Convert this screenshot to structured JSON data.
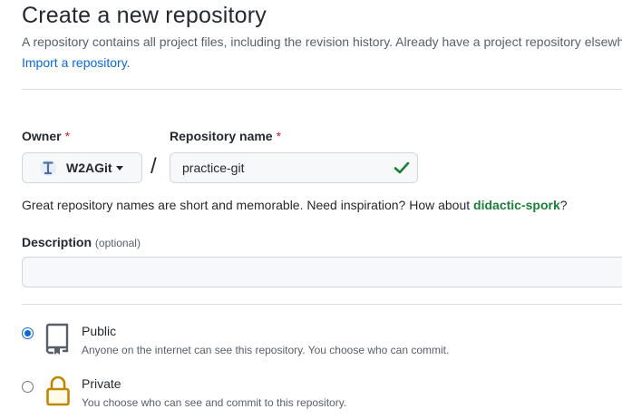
{
  "page": {
    "title": "Create a new repository",
    "subtitle": "A repository contains all project files, including the revision history. Already have a project repository elsewhere?",
    "import_link": "Import a repository."
  },
  "owner": {
    "label": "Owner",
    "required_mark": "*",
    "value": "W2AGit"
  },
  "repo": {
    "label": "Repository name",
    "required_mark": "*",
    "separator": "/",
    "value": "practice-git"
  },
  "hint": {
    "text": "Great repository names are short and memorable. Need inspiration? How about ",
    "suggestion": "didactic-spork",
    "end": "?"
  },
  "description": {
    "label": "Description",
    "optional": "(optional)",
    "value": ""
  },
  "visibility": {
    "public": {
      "title": "Public",
      "desc": "Anyone on the internet can see this repository. You choose who can commit.",
      "selected": true
    },
    "private": {
      "title": "Private",
      "desc": "You choose who can see and commit to this repository.",
      "selected": false
    }
  },
  "colors": {
    "link": "#0969da",
    "success": "#1a7f37",
    "required": "#cf222e",
    "lock": "#bf8700"
  }
}
